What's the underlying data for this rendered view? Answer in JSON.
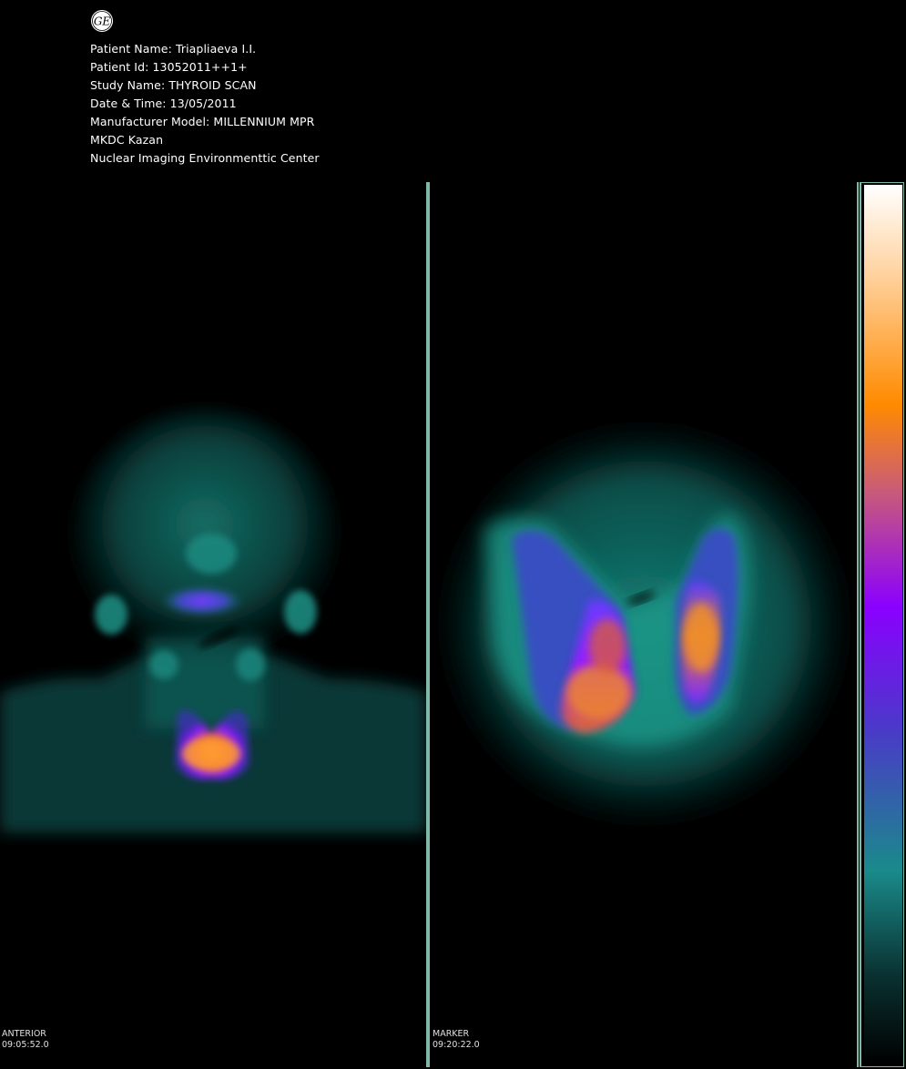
{
  "header": {
    "logo_icon": "ge-logo-icon",
    "lines": [
      "Patient Name: Triapliaeva I.I.",
      "Patient Id: 13052011++1+",
      "Study Name: THYROID SCAN",
      "Date & Time: 13/05/2011",
      "Manufacturer Model: MILLENNIUM MPR",
      "MKDC Kazan",
      "Nuclear Imaging Environmenttic Center"
    ]
  },
  "panels": {
    "left": {
      "view": "ANTERIOR",
      "time": "09:05:52.0"
    },
    "right": {
      "view": "MARKER",
      "time": "09:20:22.0"
    }
  },
  "colorbar": {
    "stops": [
      "#ffffff",
      "#ffd3a0",
      "#ff8a00",
      "#c85a7a",
      "#8a00ff",
      "#4a3ac8",
      "#1a8a8a",
      "#0a3030",
      "#000000"
    ]
  },
  "colors": {
    "divider": "#7fb8a8",
    "background": "#000000",
    "low_activity": "#0e5a55",
    "mid_activity": "#7a2cff",
    "high_activity": "#ff9a30"
  }
}
